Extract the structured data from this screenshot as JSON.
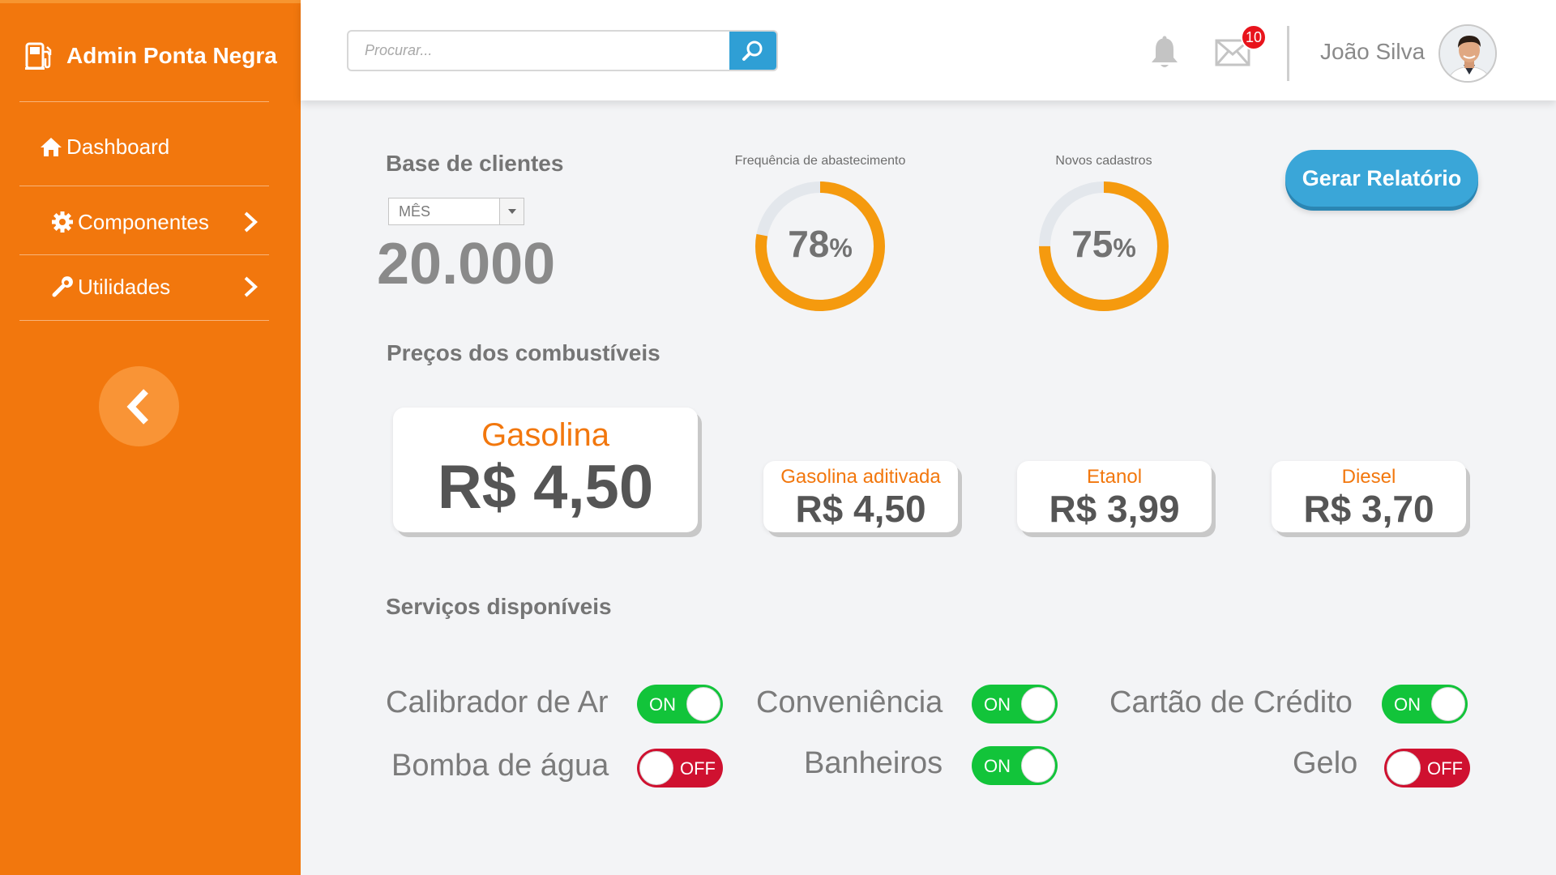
{
  "sidebar": {
    "brand": "Admin Ponta Negra",
    "items": [
      {
        "label": "Dashboard",
        "icon": "home-icon"
      },
      {
        "label": "Componentes",
        "icon": "gear-icon"
      },
      {
        "label": "Utilidades",
        "icon": "wrench-icon"
      }
    ]
  },
  "topbar": {
    "search_placeholder": "Procurar...",
    "mail_badge": "10",
    "user_name": "João Silva"
  },
  "clients": {
    "title": "Base de clientes",
    "period": "MÊS",
    "value": "20.000"
  },
  "gauges": [
    {
      "label": "Frequência de abastecimento",
      "value": 78,
      "value_text": "78",
      "unit": "%"
    },
    {
      "label": "Novos cadastros",
      "value": 75,
      "value_text": "75",
      "unit": "%"
    }
  ],
  "report_button": "Gerar Relatório",
  "fuel": {
    "title": "Preços dos combustíveis",
    "items": [
      {
        "name": "Gasolina",
        "price": "R$ 4,50"
      },
      {
        "name": "Gasolina aditivada",
        "price": "R$ 4,50"
      },
      {
        "name": "Etanol",
        "price": "R$ 3,99"
      },
      {
        "name": "Diesel",
        "price": "R$ 3,70"
      }
    ]
  },
  "services": {
    "title": "Serviços disponíveis",
    "items": [
      {
        "label": "Calibrador de Ar",
        "state": "ON"
      },
      {
        "label": "Conveniência",
        "state": "ON"
      },
      {
        "label": "Cartão de Crédito",
        "state": "ON"
      },
      {
        "label": "Bomba de água",
        "state": "OFF"
      },
      {
        "label": "Banheiros",
        "state": "ON"
      },
      {
        "label": "Gelo",
        "state": "OFF"
      }
    ]
  },
  "colors": {
    "primary": "#f2770d",
    "accent": "#3aa6d8",
    "on": "#12c43a",
    "off": "#cf1130",
    "gauge_track": "#e3e7ec"
  }
}
